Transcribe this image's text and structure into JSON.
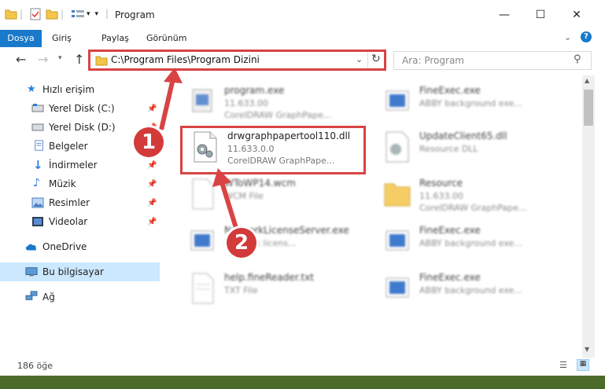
{
  "window": {
    "title": "Program",
    "minimize_glyph": "—",
    "maximize_glyph": "☐",
    "close_glyph": "✕"
  },
  "ribbon": {
    "tabs": [
      "Dosya",
      "Giriş",
      "Paylaş",
      "Görünüm"
    ]
  },
  "nav": {
    "address": "C:\\Program Files\\Program Dizini",
    "search_placeholder": "Ara: Program"
  },
  "sidebar": {
    "items": [
      {
        "label": "Hızlı erişim",
        "icon": "star-icon"
      },
      {
        "label": "Yerel Disk (C:)",
        "icon": "drive-icon",
        "pinned": true
      },
      {
        "label": "Yerel Disk (D:)",
        "icon": "drive-icon",
        "pinned": true
      },
      {
        "label": "Belgeler",
        "icon": "documents-icon",
        "pinned": true
      },
      {
        "label": "İndirmeler",
        "icon": "download-icon",
        "pinned": true
      },
      {
        "label": "Müzik",
        "icon": "music-icon",
        "pinned": true
      },
      {
        "label": "Resimler",
        "icon": "pictures-icon",
        "pinned": true
      },
      {
        "label": "Videolar",
        "icon": "videos-icon",
        "pinned": true
      },
      {
        "label": "OneDrive",
        "icon": "cloud-icon"
      },
      {
        "label": "Bu bilgisayar",
        "icon": "computer-icon",
        "selected": true
      },
      {
        "label": "Ağ",
        "icon": "network-icon"
      }
    ]
  },
  "files": [
    {
      "name": "program.exe",
      "line2": "11.633.00",
      "line3": "CorelDRAW GraphPape...",
      "blurred": true
    },
    {
      "name": "FineExec.exe",
      "line2": "ABBY background exe...",
      "line3": "",
      "blurred": true
    },
    {
      "name": "drwgraphpapertool110.dll",
      "line2": "11.633.0.0",
      "line3": "CorelDRAW GraphPape...",
      "blurred": false
    },
    {
      "name": "UpdateClient65.dll",
      "line2": "Resource DLL",
      "line3": "",
      "blurred": true
    },
    {
      "name": "WToWP14.wcm",
      "line2": "WCM File",
      "line3": "",
      "blurred": true
    },
    {
      "name": "Resource",
      "line2": "11.633.00",
      "line3": "CorelDRAW GraphPape...",
      "blurred": true
    },
    {
      "name": "NetworkLicenseServer.exe",
      "line2": "Network licens...",
      "line3": "",
      "blurred": true
    },
    {
      "name": "FineExec.exe",
      "line2": "ABBY background exe...",
      "line3": "",
      "blurred": true
    },
    {
      "name": "help.fineReader.txt",
      "line2": "TXT File",
      "line3": "",
      "blurred": true
    },
    {
      "name": "FineExec.exe",
      "line2": "ABBY background exe...",
      "line3": "",
      "blurred": true
    }
  ],
  "status": {
    "count": "186 öğe"
  },
  "callouts": [
    "1",
    "2"
  ],
  "colors": {
    "accent": "#1979ca",
    "highlight": "#d94343",
    "selected_bg": "#cce8ff"
  }
}
